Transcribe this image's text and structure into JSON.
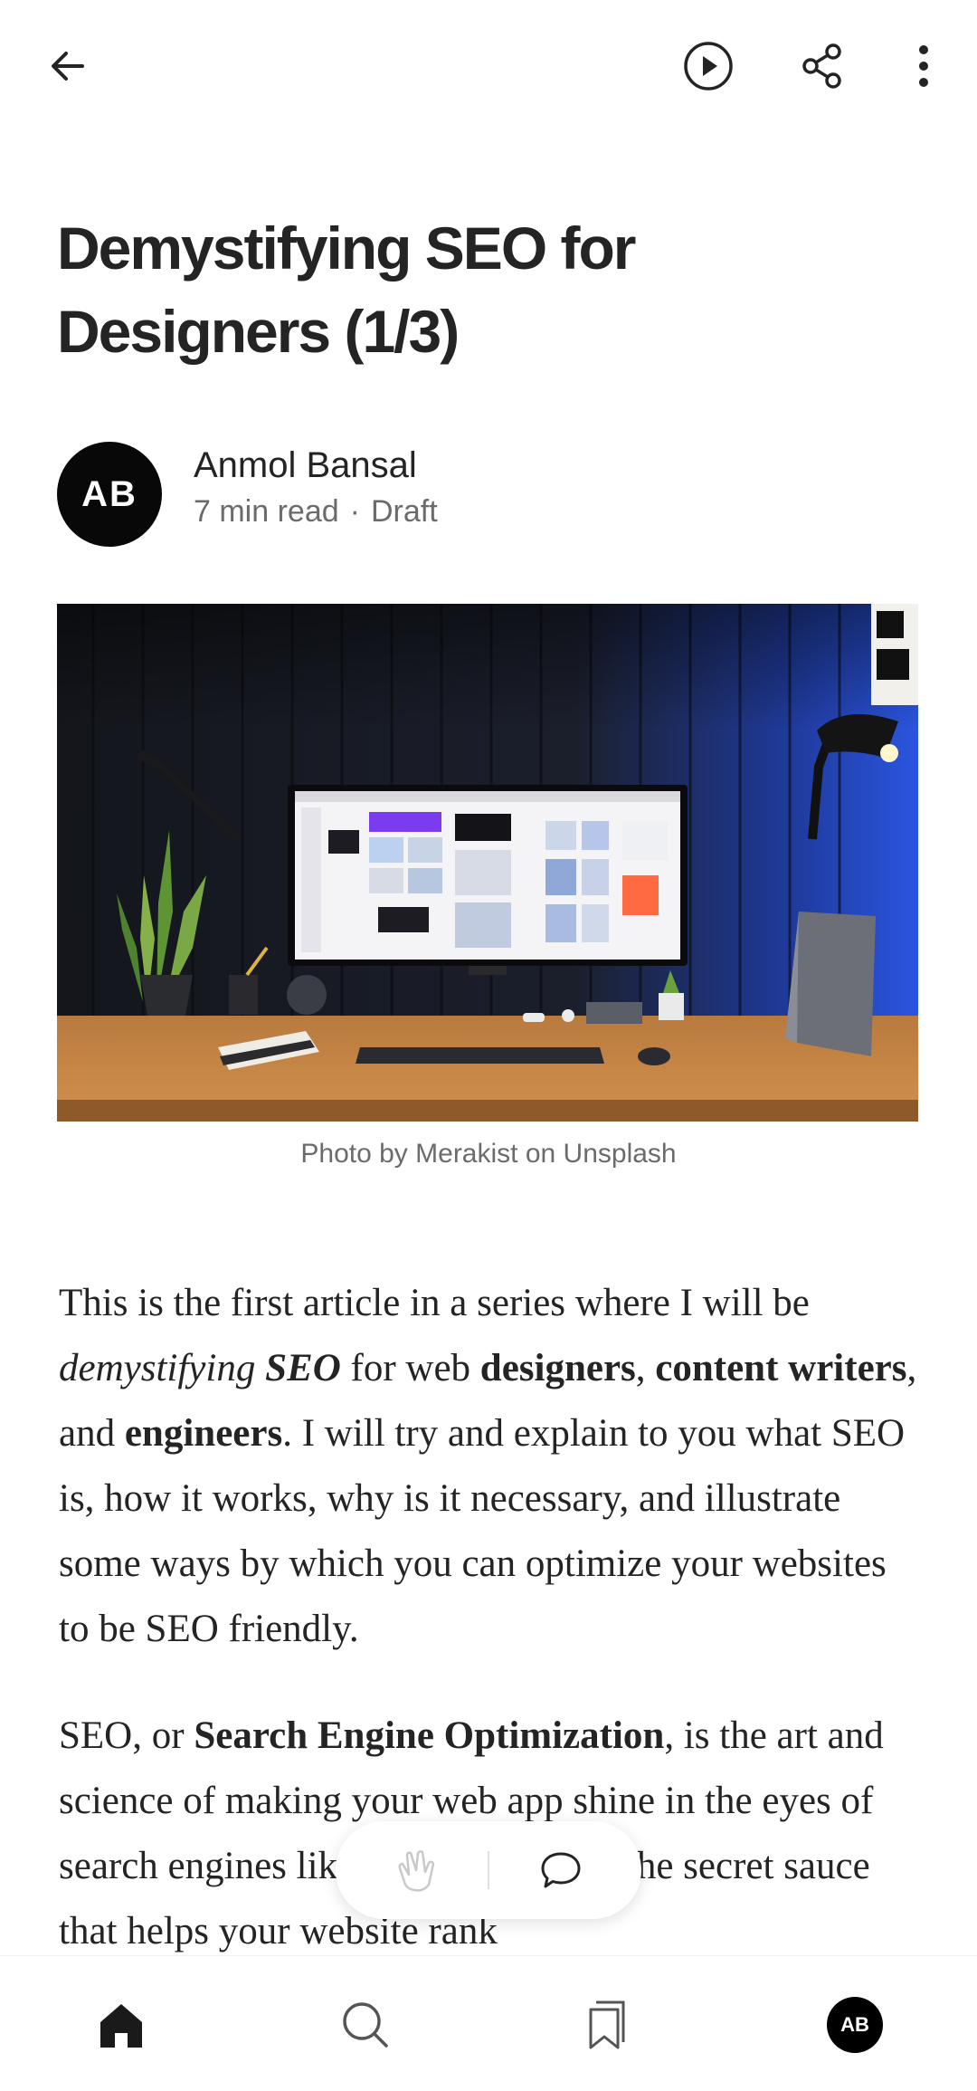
{
  "article": {
    "title": "Demystifying SEO for Designers (1/3)",
    "author": {
      "name": "Anmol Bansal",
      "initials": "AB"
    },
    "read_time": "7 min read",
    "meta_separator": "·",
    "status": "Draft",
    "image_caption": "Photo by Merakist on Unsplash"
  },
  "body": {
    "p1": {
      "t1": "This is the first article in a series where I will be ",
      "em1": "demystifying",
      "t2": " ",
      "strong_em1": "SEO",
      "t3": " for web ",
      "b1": "designers",
      "t4": ", ",
      "b2": "content writers",
      "t5": ", and ",
      "b3": "engineers",
      "t6": ". I will try and explain to you what SEO is, how it works, why is it necessary, and illustrate some ways by which you can optimize your websites to be SEO friendly."
    },
    "p2": {
      "t1": "SEO, or ",
      "b1": "Search Engine Optimization",
      "t2": ", is the art and science of making your web app shine in the eyes of search engines like Google. It’s like the secret sauce that helps your website rank"
    }
  },
  "icons": {
    "back": "arrow-left-icon",
    "listen": "play-icon",
    "share": "share-icon",
    "more": "more-vertical-icon",
    "clap": "clap-icon",
    "comment": "comment-icon",
    "home": "home-icon",
    "search": "search-icon",
    "library": "bookmarks-icon"
  },
  "colors": {
    "text": "#242424",
    "muted": "#6b6b6b",
    "avatar_bg": "#080808"
  }
}
